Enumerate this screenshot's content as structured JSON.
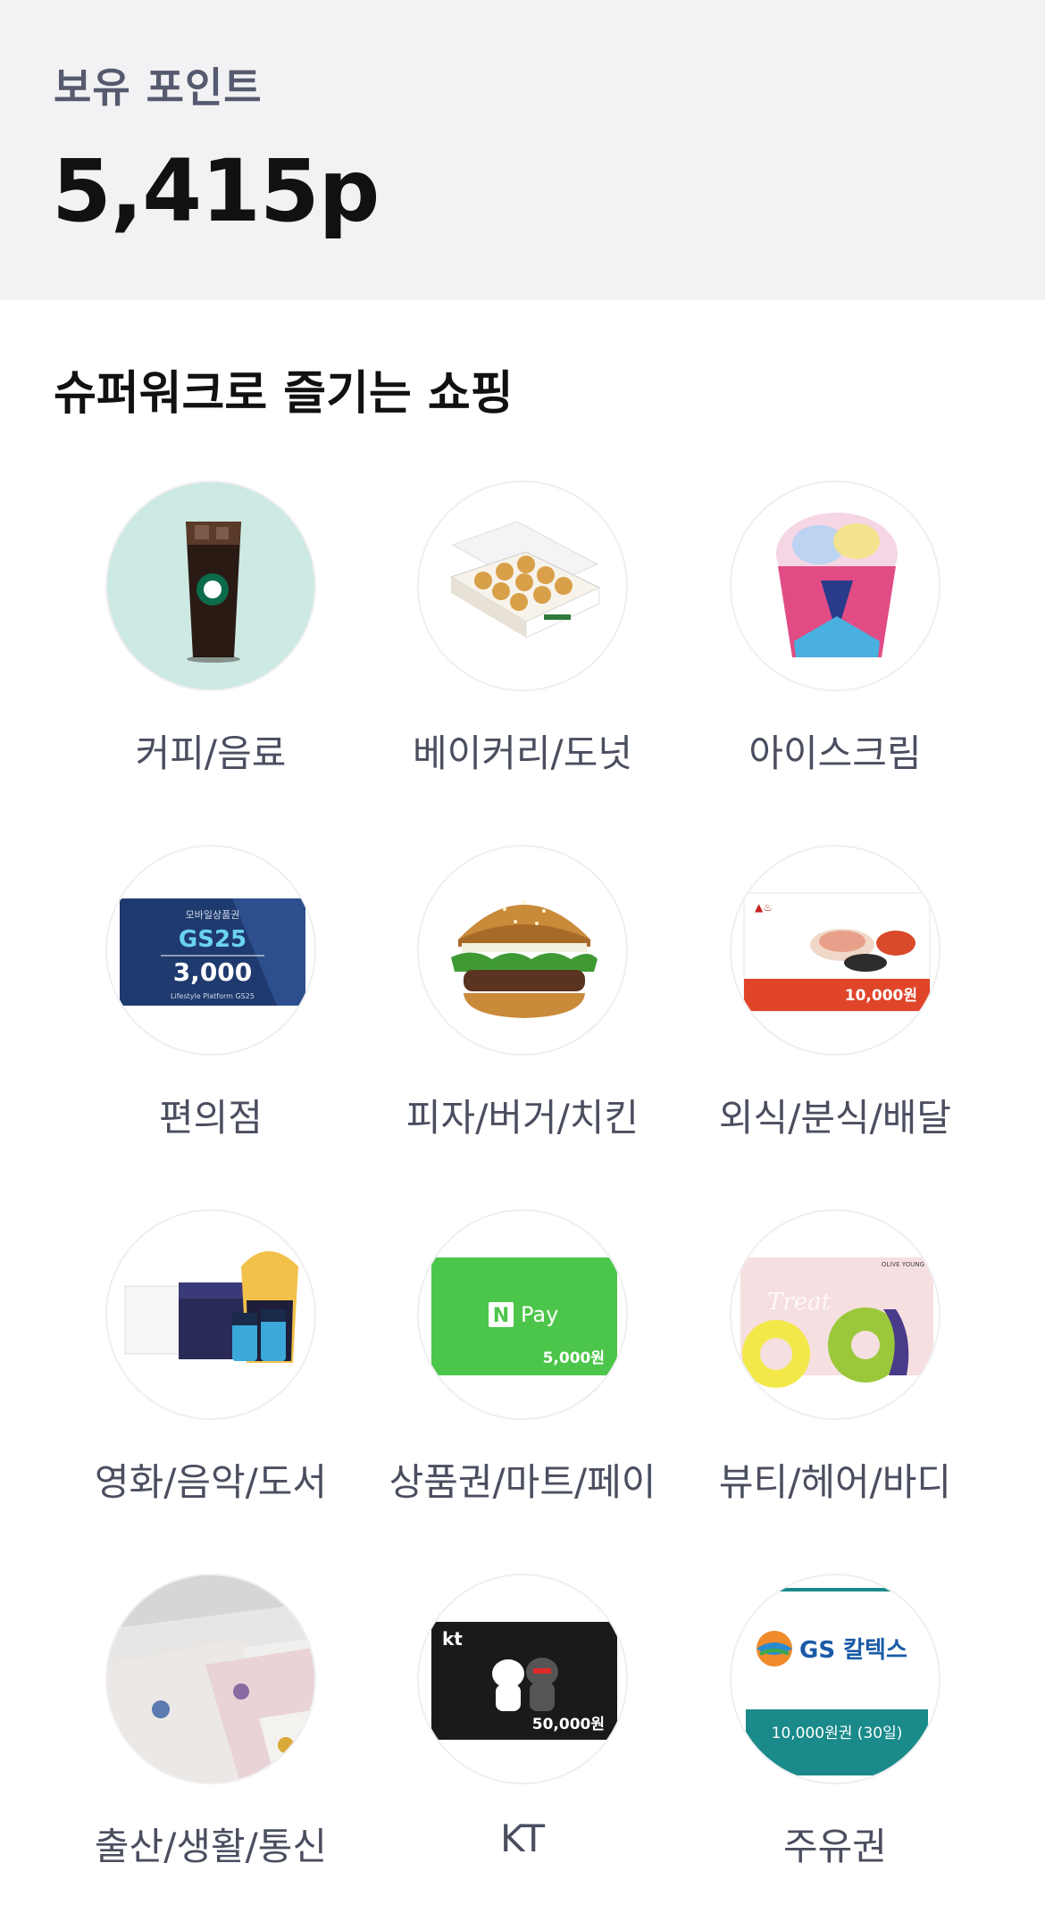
{
  "points": {
    "label": "보유 포인트",
    "value": "5,415p"
  },
  "section": {
    "title": "슈퍼워크로 즐기는 쇼핑"
  },
  "categories": [
    {
      "label": "커피/음료",
      "icon": "iced-coffee-icon"
    },
    {
      "label": "베이커리/도넛",
      "icon": "donut-box-icon"
    },
    {
      "label": "아이스크림",
      "icon": "ice-cream-cup-icon"
    },
    {
      "label": "편의점",
      "icon": "gs25-gift-card-icon"
    },
    {
      "label": "피자/버거/치킨",
      "icon": "burger-icon"
    },
    {
      "label": "외식/분식/배달",
      "icon": "restaurant-voucher-icon"
    },
    {
      "label": "영화/음악/도서",
      "icon": "movie-ticket-popcorn-icon"
    },
    {
      "label": "상품권/마트/페이",
      "icon": "npay-coupon-icon"
    },
    {
      "label": "뷰티/헤어/바디",
      "icon": "beauty-gift-card-icon"
    },
    {
      "label": "출산/생활/통신",
      "icon": "baby-towel-icon"
    },
    {
      "label": "KT",
      "icon": "kt-gift-card-icon"
    },
    {
      "label": "주유권",
      "icon": "gs-caltex-fuel-icon"
    }
  ],
  "thumb_text": {
    "gs25_top": "모바일상품권",
    "gs25_brand": "GS25",
    "gs25_amount": "3,000",
    "gs25_footer": "Lifestyle Platform GS25",
    "rest_amount": "10,000원",
    "npay_brand": "Pay",
    "npay_amount": "5,000원",
    "kt_brand": "kt",
    "kt_amount": "50,000원",
    "gs_caltex_brand": "GS 칼텍스",
    "gs_caltex_amount": "10,000원권 (30일)",
    "olive_brand": "OLIVE YOUNG"
  },
  "colors": {
    "panel_bg": "#f2f2f4",
    "label_gray": "#565a6e",
    "npay_green": "#4cc64a",
    "gs_teal": "#1a8a8a"
  }
}
